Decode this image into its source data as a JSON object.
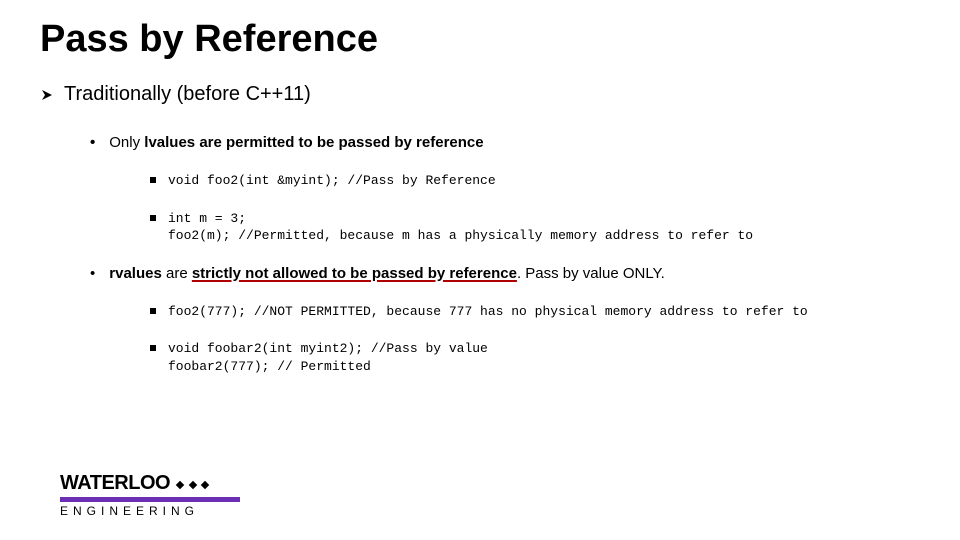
{
  "title": "Pass by Reference",
  "lvl1_text": "Traditionally (before C++11)",
  "point_lvalues_pre": "Only ",
  "point_lvalues_bold": "lvalues",
  "point_lvalues_post": " are permitted to be passed by reference",
  "code1": "void foo2(int &myint);  //Pass by Reference",
  "code2_l1": "int m = 3;",
  "code2_l2": "foo2(m);   //Permitted, because m has a physically memory address to refer to",
  "point_rvalues_bold1": "rvalues",
  "point_rvalues_mid": " are ",
  "point_rvalues_underlined": "strictly not allowed to be passed by reference",
  "point_rvalues_post": ".  Pass by value ONLY.",
  "code3": "foo2(777);      //NOT PERMITTED, because 777 has no physical memory address to refer to",
  "code4_l1": "void foobar2(int myint2);  //Pass by value",
  "code4_l2": "foobar2(777);  // Permitted",
  "logo_top": "WATERLOO",
  "logo_sub": "ENGINEERING"
}
